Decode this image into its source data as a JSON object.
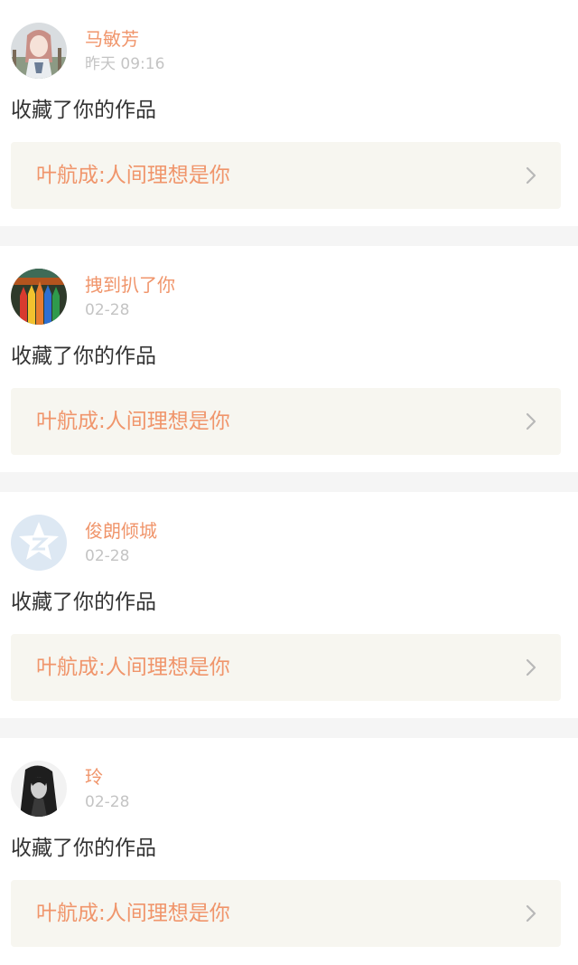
{
  "feed": {
    "items": [
      {
        "username": "马敏芳",
        "time": "昨天 09:16",
        "action": "收藏了你的作品",
        "work": "叶航成:人间理想是你",
        "avatar_icon": "anime-girl-avatar"
      },
      {
        "username": "拽到扒了你",
        "time": "02-28",
        "action": "收藏了你的作品",
        "work": "叶航成:人间理想是你",
        "avatar_icon": "colored-pencils-avatar"
      },
      {
        "username": "俊朗倾城",
        "time": "02-28",
        "action": "收藏了你的作品",
        "work": "叶航成:人间理想是你",
        "avatar_icon": "qzone-star-avatar"
      },
      {
        "username": "玲",
        "time": "02-28",
        "action": "收藏了你的作品",
        "work": "叶航成:人间理想是你",
        "avatar_icon": "woman-portrait-avatar"
      }
    ]
  },
  "colors": {
    "accent": "#f0956b",
    "muted": "#c4c4c4",
    "text": "#333333",
    "card_bg": "#f7f6f0",
    "separator": "#f5f5f5"
  }
}
